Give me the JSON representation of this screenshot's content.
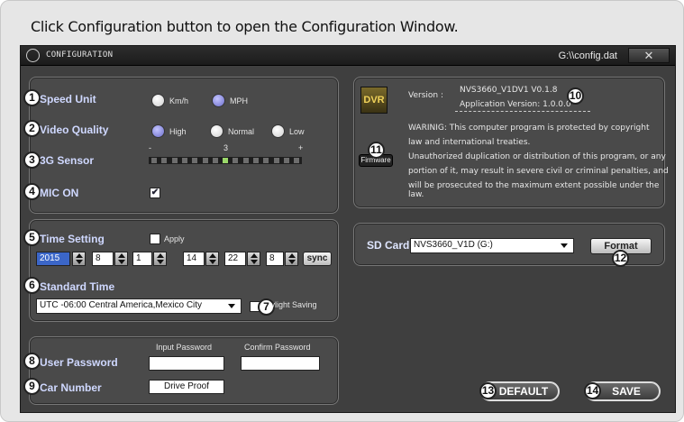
{
  "caption": "Click Configuration button to open the Configuration Window.",
  "window": {
    "title": "CONFIGURATION",
    "path": "G:\\\\config.dat",
    "close": "✕"
  },
  "settings": {
    "speed_unit": {
      "label": "Speed Unit",
      "opt1": "Km/h",
      "opt2": "MPH",
      "selected": "MPH"
    },
    "video_quality": {
      "label": "Video Quality",
      "opt1": "High",
      "opt2": "Normal",
      "opt3": "Low",
      "selected": "High"
    },
    "g_sensor": {
      "label": "3G Sensor",
      "min": "-",
      "mid": "3",
      "max": "+",
      "level": 3
    },
    "mic": {
      "label": "MIC ON",
      "checked": true
    }
  },
  "time": {
    "label": "Time Setting",
    "apply": "Apply",
    "year": "2015",
    "month": "8",
    "day": "1",
    "hour": "14",
    "minute": "22",
    "second": "8",
    "sync": "sync",
    "standard_label": "Standard Time",
    "timezone": "UTC -06:00 Central America,Mexico City",
    "daylight": "Daylight Saving"
  },
  "password": {
    "input_header": "Input Password",
    "confirm_header": "Confirm Password",
    "user_label": "User Password",
    "car_label": "Car Number",
    "car_value": "Drive Proof"
  },
  "info": {
    "logo": "DVR",
    "firmware": "Firmware",
    "version_label": "Version :",
    "version_value": "NVS3660_V1DV1  V0.1.8",
    "app_version": "Application Version: 1.0.0.0",
    "warning": [
      "WARINIG: This computer program is protected by copyright",
      "law and international treaties.",
      "Unauthorized duplication or distribution of this program, or any",
      "portion of it, may result in severe civil or criminal penalties, and",
      "will be prosecuted to the maximum extent possible under the law."
    ]
  },
  "sd": {
    "label": "SD Card",
    "value": "NVS3660_V1D (G:)",
    "format": "Format"
  },
  "actions": {
    "default": "DEFAULT",
    "save": "SAVE"
  },
  "callouts": [
    "1",
    "2",
    "3",
    "4",
    "5",
    "6",
    "7",
    "8",
    "9",
    "10",
    "11",
    "12",
    "13",
    "14"
  ]
}
